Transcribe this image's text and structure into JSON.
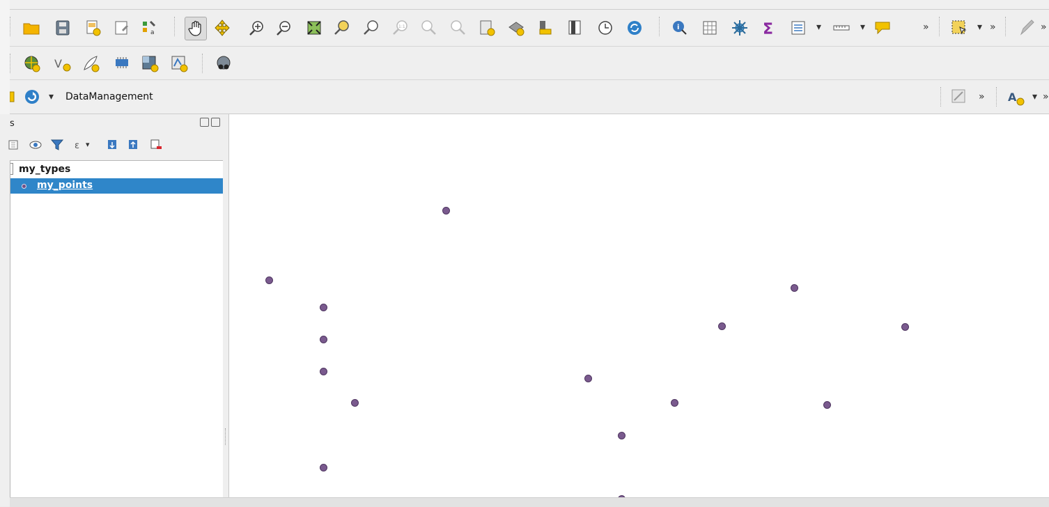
{
  "toolbars": {
    "data_management_label": "DataManagement",
    "overflow_glyph": "»",
    "dropdown_glyph": "▾",
    "row1_icons": [
      "open-project-icon",
      "save-project-icon",
      "new-print-layout-icon",
      "layout-manager-icon",
      "style-manager-icon",
      "pan-map-icon",
      "pan-to-selection-icon",
      "zoom-in-icon",
      "zoom-out-icon",
      "zoom-full-icon",
      "zoom-to-selection-icon",
      "zoom-to-layer-icon",
      "zoom-native-resolution-icon",
      "zoom-last-icon",
      "zoom-next-icon",
      "new-spatial-bookmark-icon",
      "show-bookmarks-icon",
      "new-3d-map-icon",
      "new-map-view-icon",
      "temporal-controller-icon",
      "refresh-icon",
      "identify-features-icon",
      "open-attribute-table-icon",
      "toolbox-icon",
      "statistical-summary-icon",
      "open-field-calculator-icon",
      "measure-line-icon",
      "show-map-tips-icon",
      "select-features-icon",
      "digitize-icon"
    ],
    "row2_icons": [
      "add-wms-layer-icon",
      "add-virtual-layer-icon",
      "new-shapefile-layer-icon",
      "add-mesh-layer-icon",
      "add-raster-layer-icon",
      "add-vector-layer-icon",
      "metasearch-icon"
    ],
    "row3_icons": [
      "project-icon",
      "rotate-icon",
      "digitize-shape-icon",
      "label-toolbar-icon"
    ]
  },
  "layers_panel": {
    "title": "s",
    "toolbar_icons": [
      "layer-style-icon",
      "manage-map-themes-icon",
      "filter-legend-icon",
      "filter-by-expression-icon",
      "expand-all-icon",
      "collapse-all-icon",
      "remove-layer-icon"
    ],
    "group_name": "my_types",
    "selected_layer": "my_points"
  },
  "map_canvas": {
    "point_color": "#7a5a8e",
    "feature_count": 18,
    "background": "#ffffff"
  },
  "colors": {
    "selection": "#2f86c9",
    "toolbar_bg": "#efefef"
  }
}
